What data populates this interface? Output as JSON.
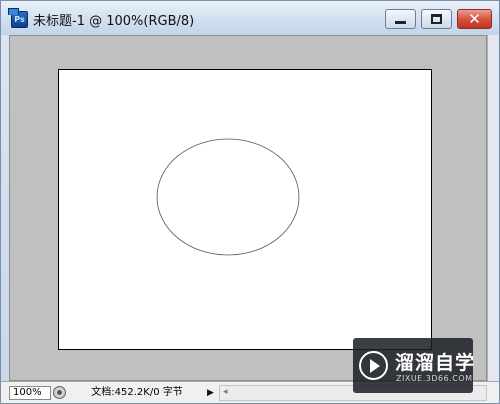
{
  "window": {
    "title": "未标题-1 @ 100%(RGB/8)",
    "app_icon_text": "Ps",
    "buttons": {
      "close_glyph": "✕"
    }
  },
  "canvas": {
    "background": "#ffffff",
    "workspace_color": "#c0c0c0",
    "shape": {
      "type": "ellipse",
      "stroke": "#555555",
      "fill": "none"
    }
  },
  "statusbar": {
    "zoom": "100%",
    "doc_info": "文档:452.2K/0 字节",
    "menu_arrow": "▶",
    "scroll_left_arrow": "◂"
  },
  "watermark": {
    "title": "溜溜自学",
    "url": "ZIXUE.3D66.COM"
  }
}
